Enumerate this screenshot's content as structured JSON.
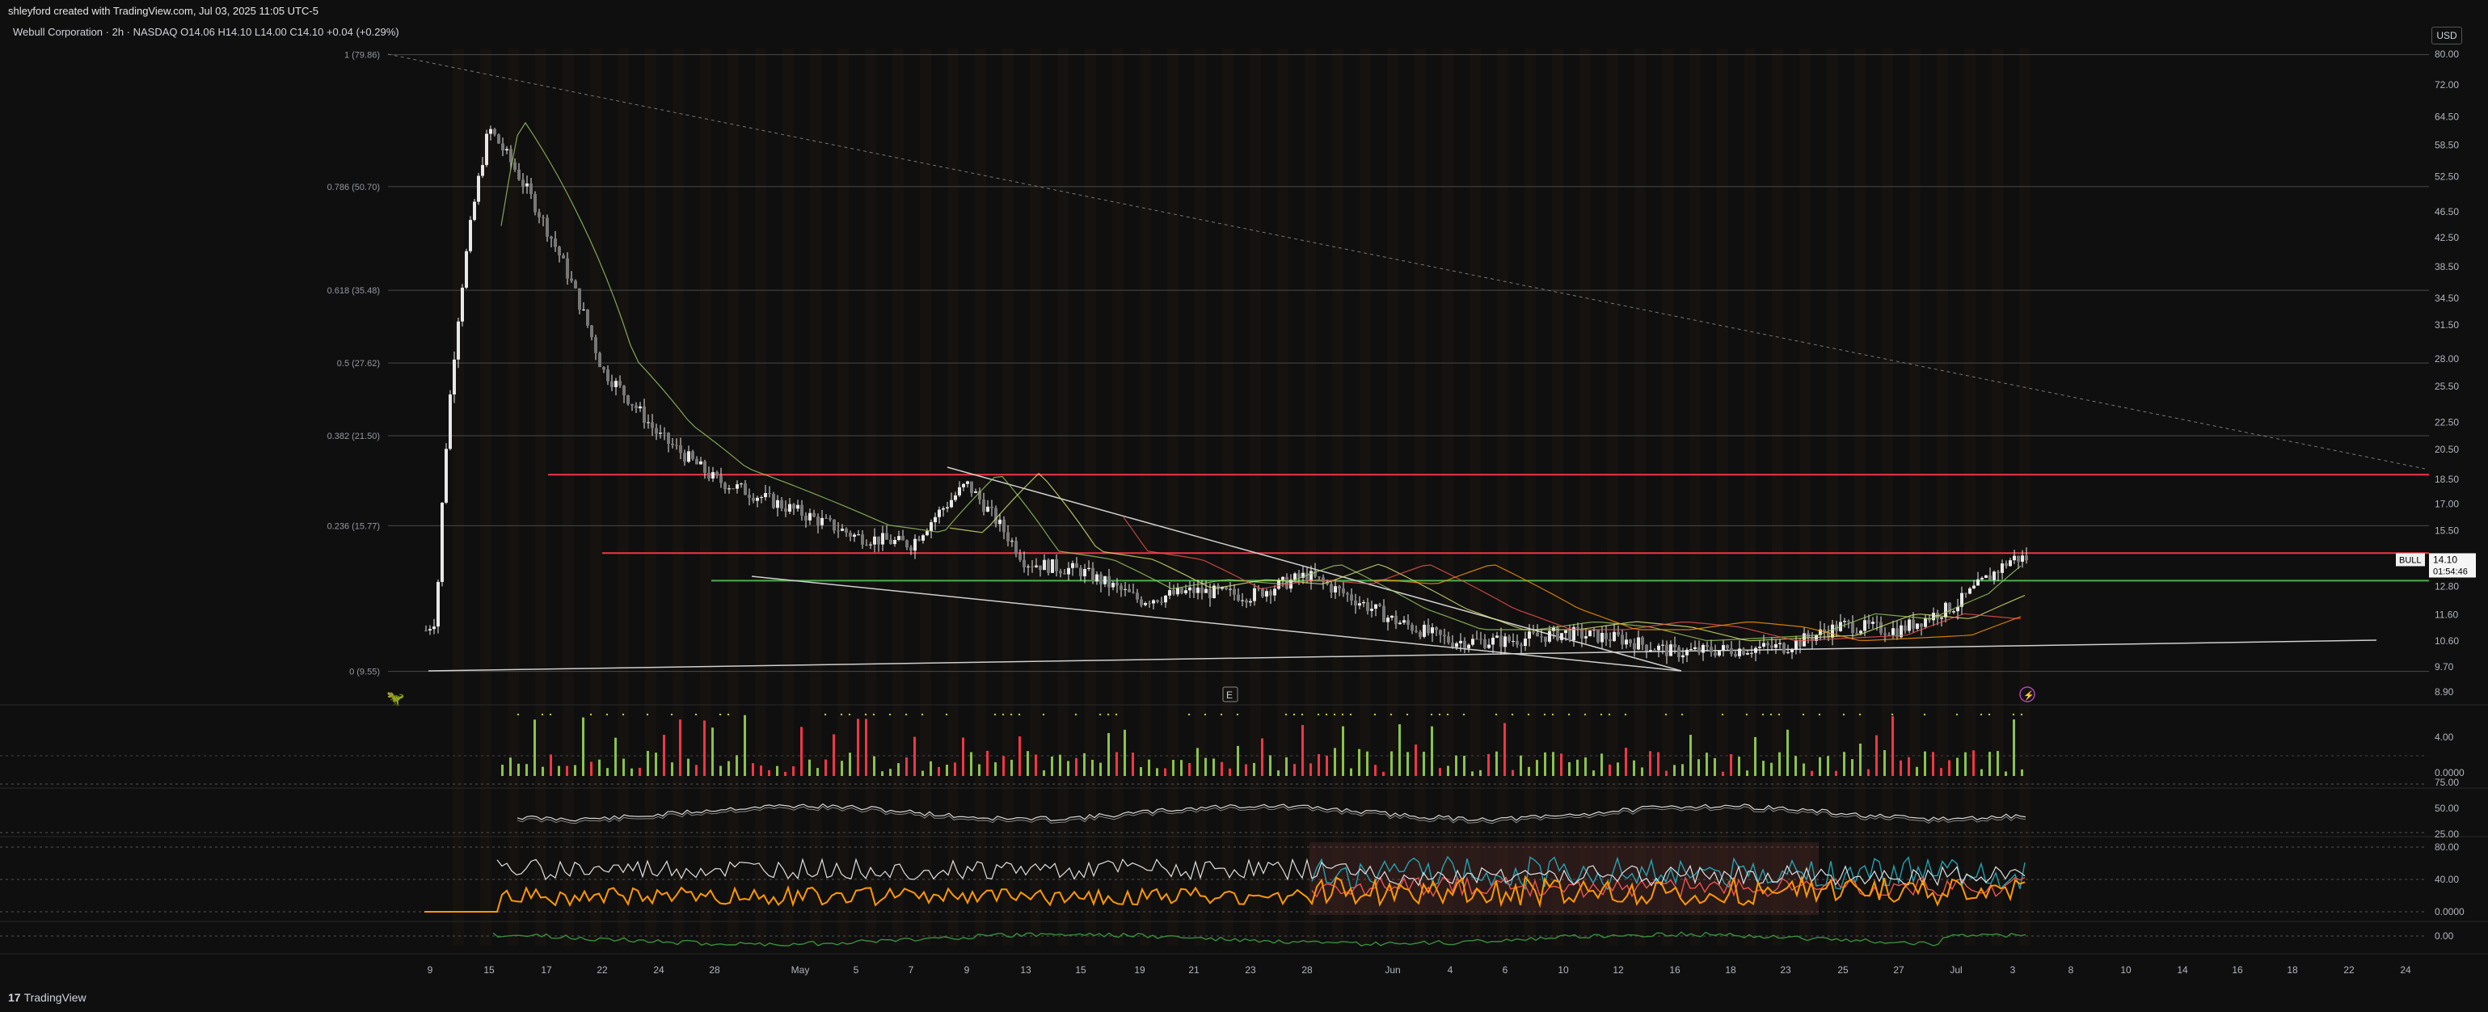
{
  "header": {
    "attribution": "shleyford created with TradingView.com, Jul 03, 2025 11:05 UTC-5"
  },
  "legend": {
    "symbol": "Webull Corporation · 2h · NASDAQ",
    "open_label": "O",
    "open": "14.06",
    "high_label": "H",
    "high": "14.10",
    "low_label": "L",
    "low": "14.00",
    "close_label": "C",
    "close": "14.10",
    "change": "+0.04 (+0.29%)"
  },
  "currency_button": "USD",
  "price_tag": {
    "ticker": "BULL",
    "price": "14.10",
    "countdown": "01:54:46"
  },
  "footer": {
    "brand_mark": "17",
    "brand": "TradingView"
  },
  "event_markers": {
    "earnings": "E",
    "dividend_icon": "lightning-icon",
    "mascot_icon": "dinosaur-icon"
  },
  "colors": {
    "background": "#0f0f0f",
    "candles": "#e8e8e8",
    "resistance_line": "#f23645",
    "support_line": "#4caf50",
    "volume_up": "#8bc34a",
    "volume_down": "#f23645",
    "orange_line": "#ff9800",
    "cyan_line": "#26c6da",
    "stochrsi_band": "#5d2f2c"
  },
  "chart_data": [
    {
      "type": "candlestick",
      "title": "",
      "price_axis_ticks": [
        "80.00",
        "72.00",
        "64.50",
        "58.50",
        "52.50",
        "46.50",
        "42.50",
        "38.50",
        "34.50",
        "31.50",
        "28.00",
        "25.50",
        "22.50",
        "20.50",
        "18.50",
        "17.00",
        "15.50",
        "14.10",
        "12.80",
        "11.60",
        "10.60",
        "9.70",
        "8.90"
      ],
      "time_axis_ticks": [
        "9",
        "15",
        "17",
        "22",
        "24",
        "28",
        "May",
        "5",
        "7",
        "9",
        "13",
        "15",
        "19",
        "21",
        "23",
        "28",
        "Jun",
        "4",
        "6",
        "10",
        "12",
        "16",
        "18",
        "23",
        "25",
        "27",
        "Jul",
        "3",
        "8",
        "10",
        "14",
        "16",
        "18",
        "22",
        "24"
      ],
      "fibonacci_levels": [
        {
          "label": "1 (79.86)",
          "value": 79.86
        },
        {
          "label": "0.786 (50.70)",
          "value": 50.7
        },
        {
          "label": "0.618 (35.48)",
          "value": 35.48
        },
        {
          "label": "0.5 (27.62)",
          "value": 27.62
        },
        {
          "label": "0.382 (21.50)",
          "value": 21.5
        },
        {
          "label": "0.236 (15.77)",
          "value": 15.77
        },
        {
          "label": "0 (9.55)",
          "value": 9.55
        }
      ],
      "horizontal_levels": [
        {
          "name": "resistance-upper",
          "value": 18.8,
          "color": "#f23645"
        },
        {
          "name": "resistance-lower",
          "value": 14.35,
          "color": "#f23645"
        },
        {
          "name": "support",
          "value": 13.05,
          "color": "#4caf50"
        }
      ],
      "close_series_approx": [
        {
          "date": "Apr 10",
          "close": 11.2
        },
        {
          "date": "Apr 11",
          "close": 10.0
        },
        {
          "date": "Apr 14",
          "close": 72.0
        },
        {
          "date": "Apr 15",
          "close": 62.0
        },
        {
          "date": "Apr 16",
          "close": 50.0
        },
        {
          "date": "Apr 17",
          "close": 44.0
        },
        {
          "date": "Apr 21",
          "close": 30.0
        },
        {
          "date": "Apr 22",
          "close": 27.0
        },
        {
          "date": "Apr 23",
          "close": 28.0
        },
        {
          "date": "Apr 24",
          "close": 21.5
        },
        {
          "date": "Apr 28",
          "close": 18.5
        },
        {
          "date": "Apr 30",
          "close": 14.0
        },
        {
          "date": "May 2",
          "close": 13.4
        },
        {
          "date": "May 5",
          "close": 15.2
        },
        {
          "date": "May 7",
          "close": 14.8
        },
        {
          "date": "May 9",
          "close": 18.2
        },
        {
          "date": "May 13",
          "close": 13.9
        },
        {
          "date": "May 15",
          "close": 13.5
        },
        {
          "date": "May 19",
          "close": 12.2
        },
        {
          "date": "May 21",
          "close": 12.6
        },
        {
          "date": "May 23",
          "close": 12.4
        },
        {
          "date": "May 28",
          "close": 13.3
        },
        {
          "date": "Jun 2",
          "close": 11.4
        },
        {
          "date": "Jun 4",
          "close": 10.6
        },
        {
          "date": "Jun 6",
          "close": 10.6
        },
        {
          "date": "Jun 10",
          "close": 10.9
        },
        {
          "date": "Jun 12",
          "close": 10.7
        },
        {
          "date": "Jun 16",
          "close": 10.2
        },
        {
          "date": "Jun 18",
          "close": 10.3
        },
        {
          "date": "Jun 23",
          "close": 10.4
        },
        {
          "date": "Jun 25",
          "close": 11.2
        },
        {
          "date": "Jun 27",
          "close": 11.0
        },
        {
          "date": "Jul 1",
          "close": 12.0
        },
        {
          "date": "Jul 2",
          "close": 13.2
        },
        {
          "date": "Jul 3",
          "close": 14.1
        }
      ],
      "sub_panes": [
        {
          "name": "volume",
          "ticks": [
            "4.00",
            "0.0000"
          ]
        },
        {
          "name": "oscillator",
          "ticks": [
            "75.00",
            "50.00",
            "25.00"
          ]
        },
        {
          "name": "stoch_rsi",
          "ticks": [
            "80.00",
            "40.00",
            "0.0000"
          ]
        },
        {
          "name": "momentum",
          "ticks": [
            "0.00"
          ]
        }
      ]
    }
  ]
}
